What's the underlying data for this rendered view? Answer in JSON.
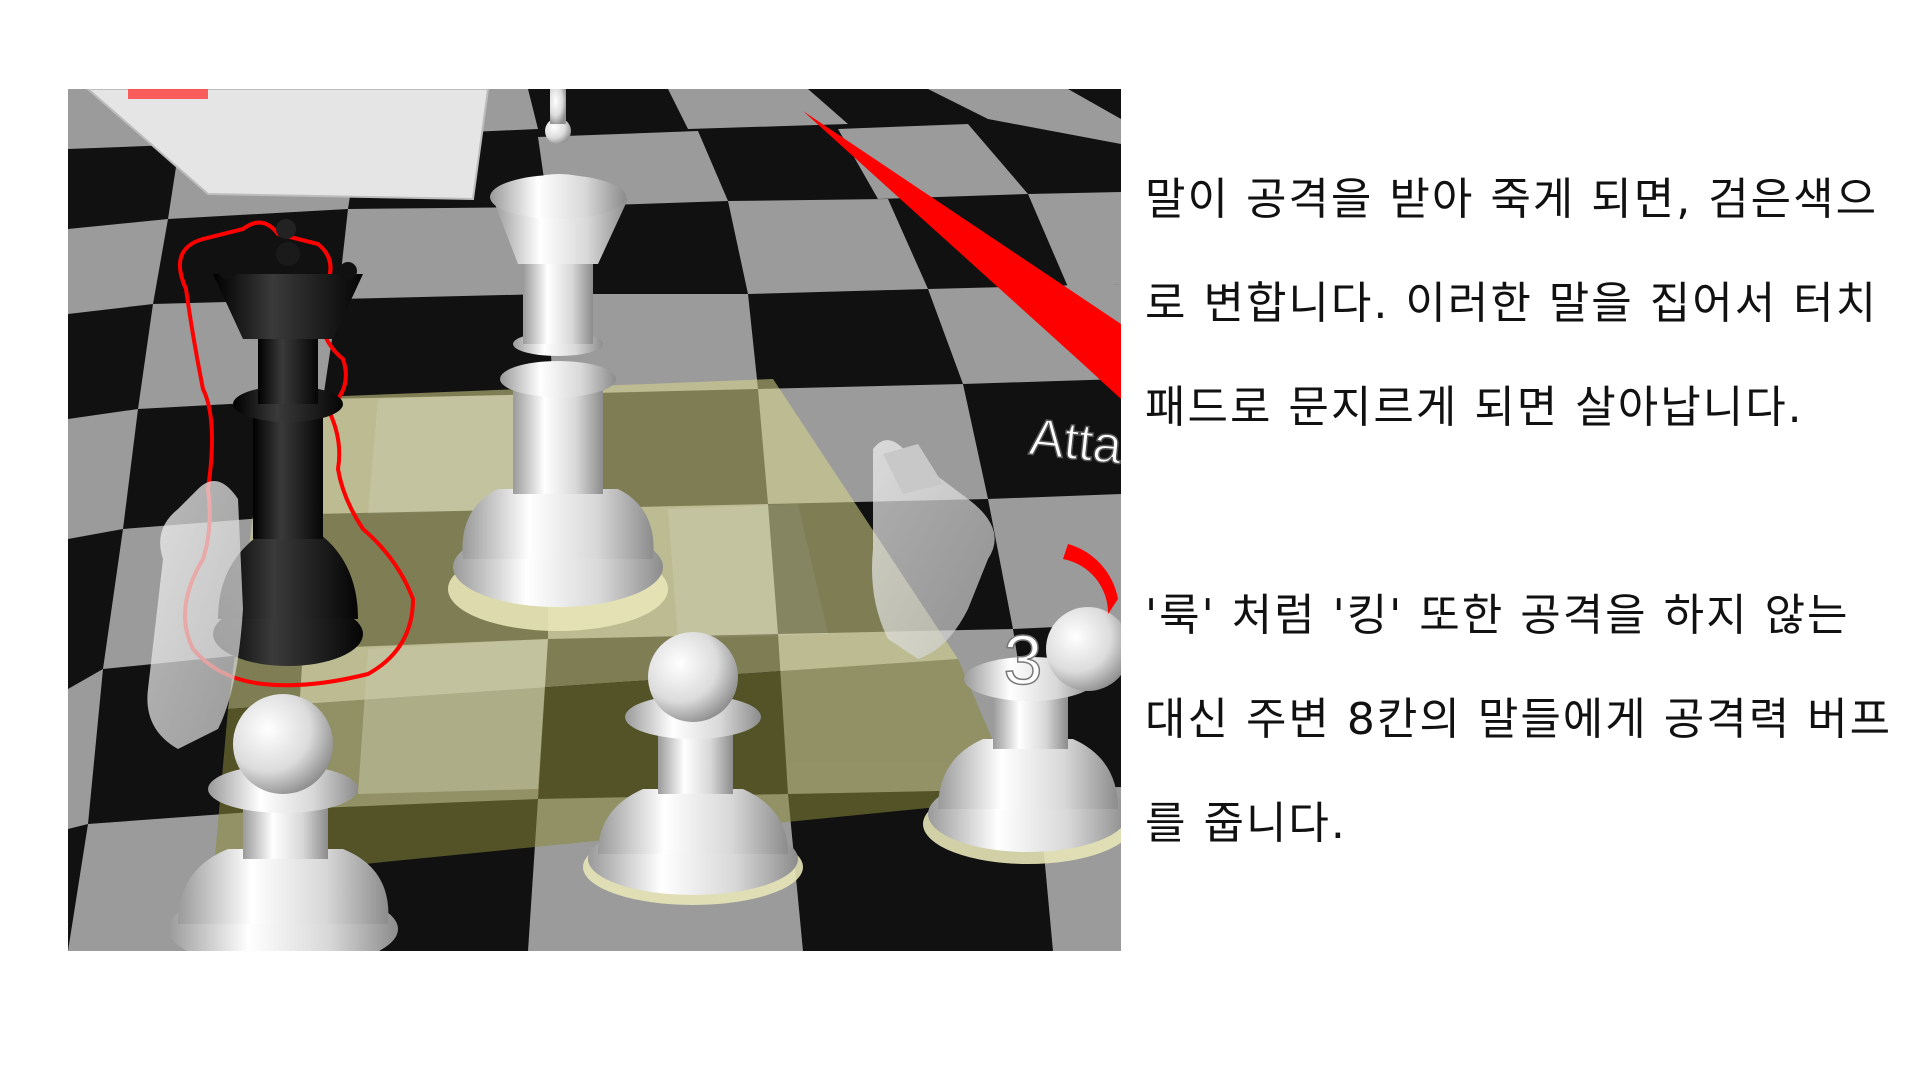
{
  "game_view": {
    "hud": {
      "action_label": "Attack",
      "counter_value": "3"
    }
  },
  "caption": {
    "paragraph_1": "말이 공격을 받아 죽게 되면, 검은색으로 변합니다. 이러한 말을 집어서 터치패드로 문지르게 되면 살아납니다.",
    "paragraph_2": "'룩' 처럼 '킹' 또한 공격을 하지 않는 대신 주변 8칸의 말들에게 공격력 버프를 줍니다."
  },
  "colors": {
    "highlight_zone": "#d8d68a",
    "attack_red": "#ff0000",
    "dead_piece": "#0a0a0a",
    "white_piece": "#e6e6e6"
  }
}
